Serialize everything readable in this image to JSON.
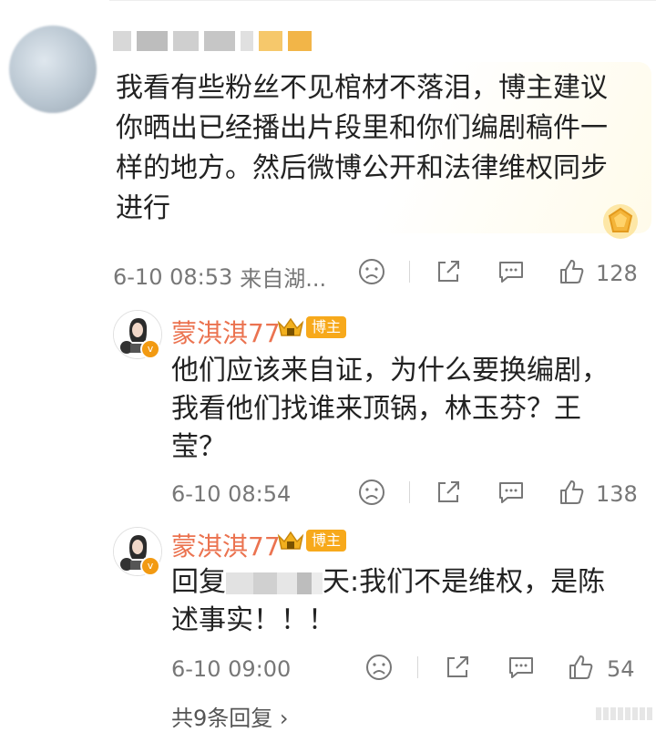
{
  "main_comment": {
    "text": "我看有些粉丝不见棺材不落泪，博主建议\n你晒出已经播出片段里和你们编剧稿件一\n样的地方。然后微博公开和法律维权同步\n进行",
    "time": "6-10 08:53",
    "source": "来自湖...",
    "likes": "128"
  },
  "replies": [
    {
      "name": "蒙淇淇77",
      "tag": "博主",
      "text": "他们应该来自证，为什么要换编剧，\n我看他们找谁来顶锅，林玉芬？王\n莹？",
      "time": "6-10 08:54",
      "likes": "138"
    },
    {
      "name": "蒙淇淇77",
      "tag": "博主",
      "reply_prefix": "回复",
      "reply_suffix": "天:我们不是维权，是陈",
      "text_line2": "述事实！！！",
      "time": "6-10 09:00",
      "likes": "54"
    }
  ],
  "more_replies": "共9条回复 ›",
  "colors": {
    "name": "#eb7350",
    "tag_bg": "#f7a91b",
    "meta": "#777777"
  },
  "icons": [
    "sad-face-icon",
    "share-icon",
    "comment-icon",
    "thumbs-up-icon",
    "crown-icon",
    "vip-gem-icon"
  ]
}
